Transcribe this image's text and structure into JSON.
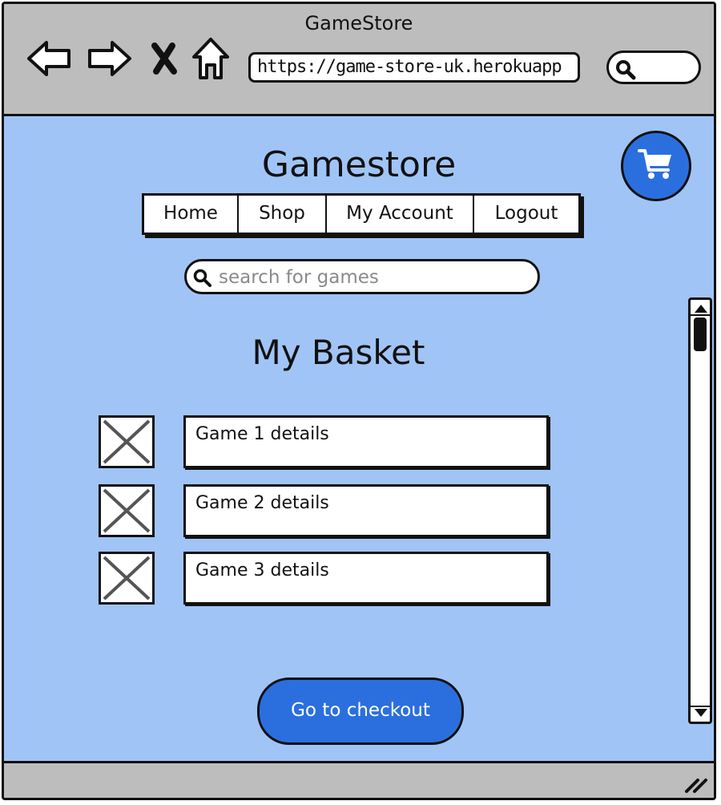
{
  "window": {
    "title": "GameStore"
  },
  "browser": {
    "url": "https://game-store-uk.herokuapp",
    "icons": {
      "back": "back-arrow-icon",
      "forward": "forward-arrow-icon",
      "stop": "close-icon",
      "home": "home-icon",
      "search": "search-icon"
    }
  },
  "header": {
    "site_title": "Gamestore",
    "cart_icon": "cart-icon"
  },
  "nav": {
    "items": [
      {
        "label": "Home"
      },
      {
        "label": "Shop"
      },
      {
        "label": "My Account"
      },
      {
        "label": "Logout"
      }
    ]
  },
  "search": {
    "placeholder": "search for games",
    "value": ""
  },
  "main": {
    "heading": "My Basket",
    "items": [
      {
        "label": "Game 1 details"
      },
      {
        "label": "Game 2 details"
      },
      {
        "label": "Game 3 details"
      }
    ],
    "checkout_label": "Go to checkout"
  },
  "colors": {
    "content_bg": "#a0c4f6",
    "accent": "#2b6fde",
    "chrome": "#bdbdbd"
  }
}
